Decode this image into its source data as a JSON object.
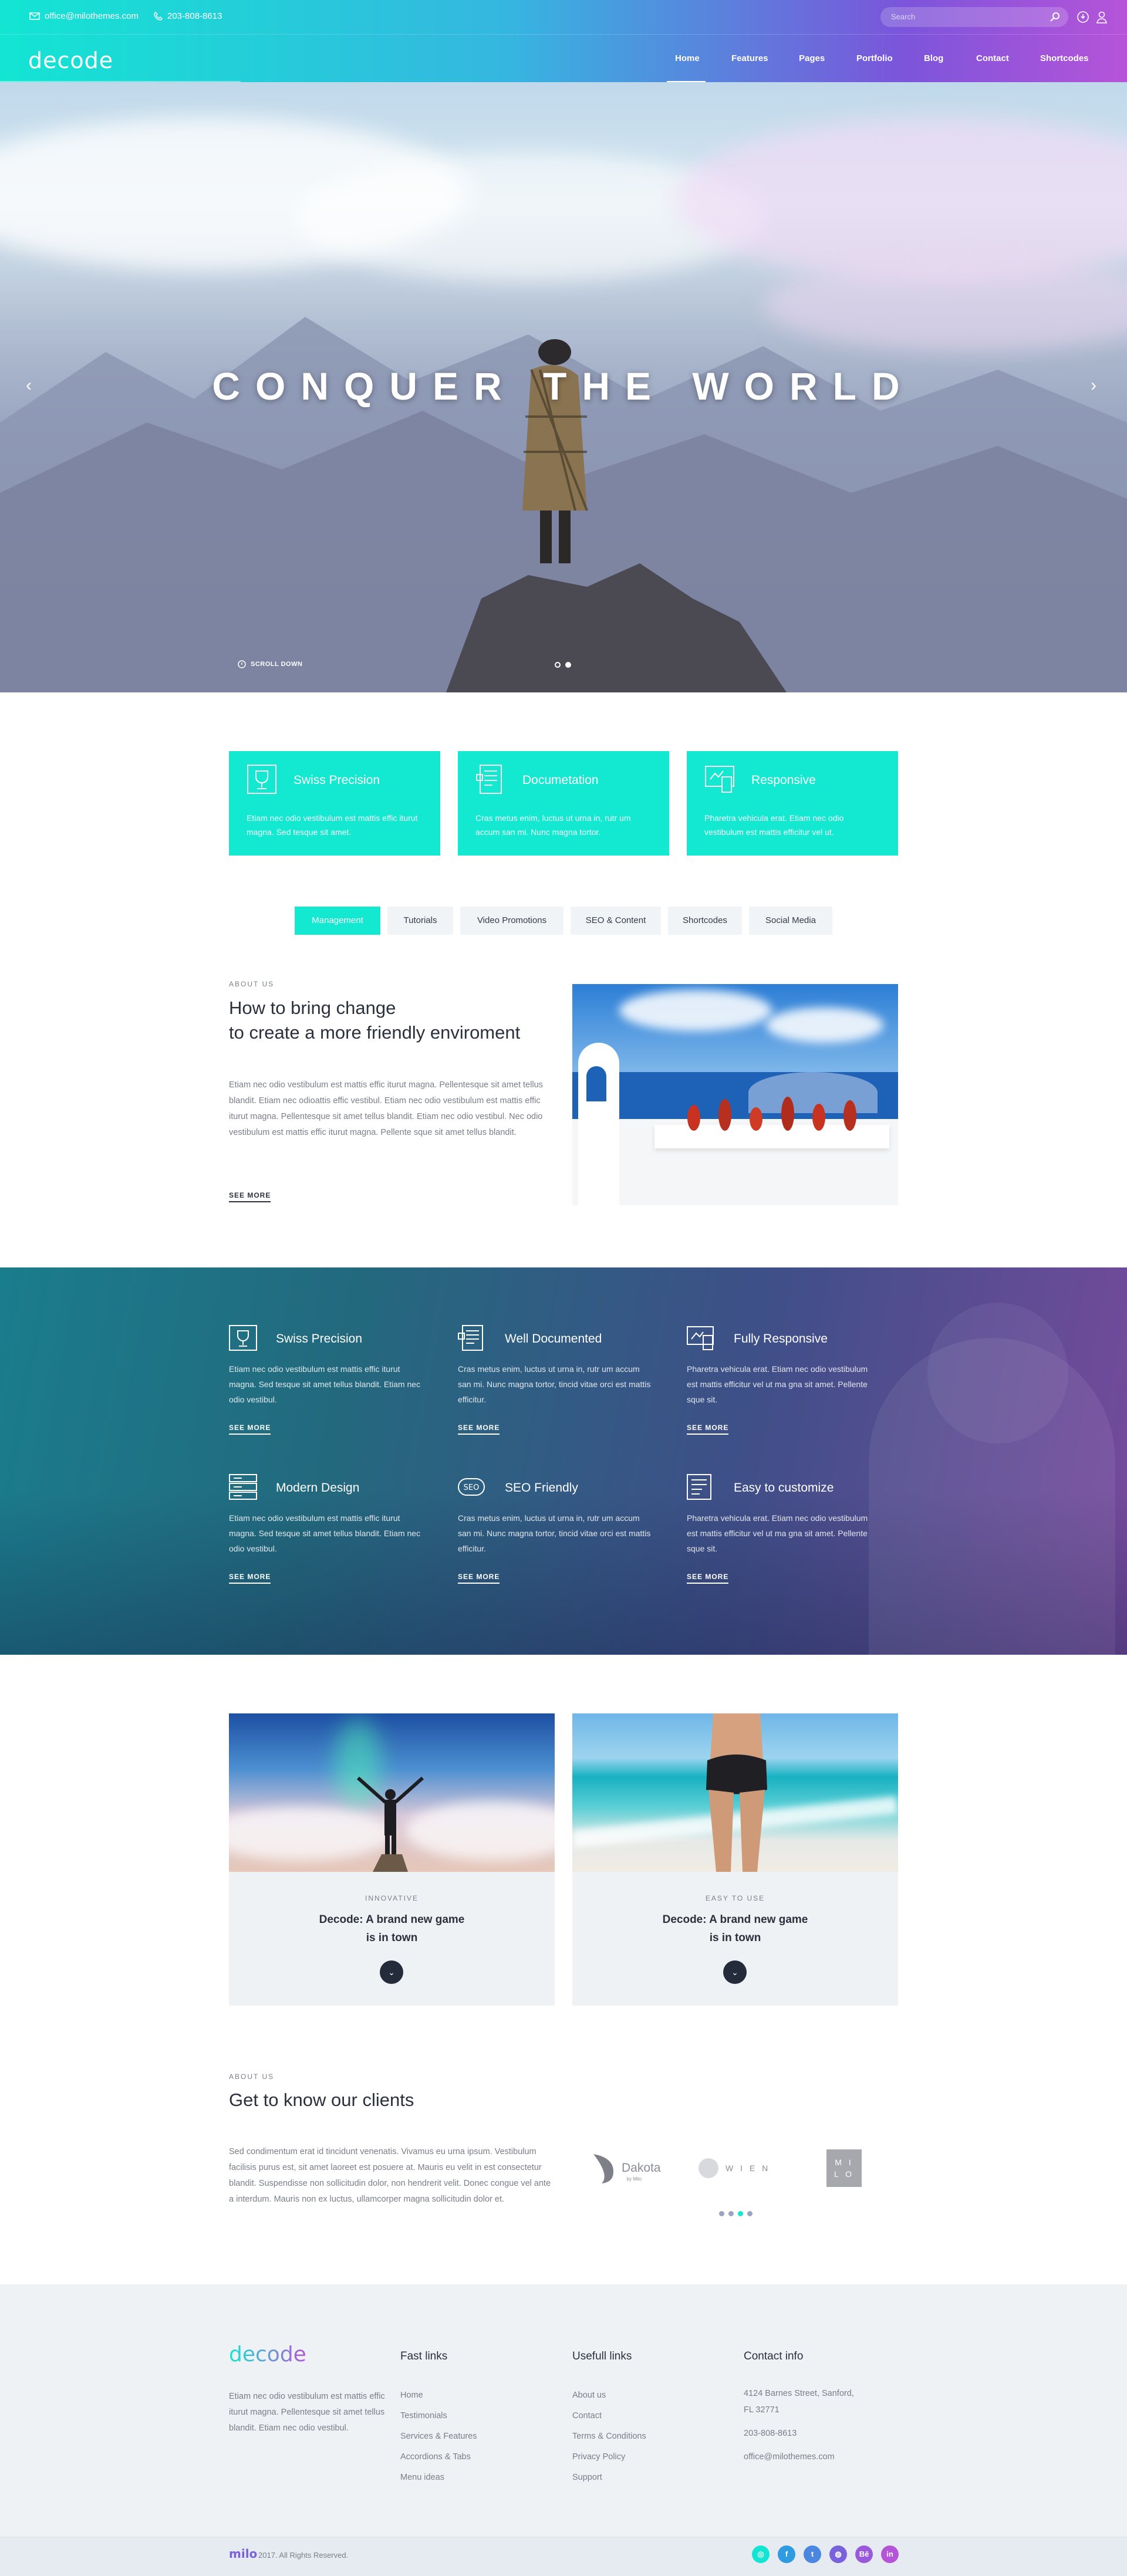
{
  "topbar": {
    "email": "office@milothemes.com",
    "phone": "203-808-8613",
    "search_placeholder": "Search",
    "icons": [
      "mail-icon",
      "phone-icon",
      "search-icon",
      "login-icon",
      "user-icon"
    ]
  },
  "nav": {
    "logo": "decode",
    "items": [
      "Home",
      "Features",
      "Pages",
      "Portfolio",
      "Blog",
      "Contact",
      "Shortcodes"
    ],
    "active": "Home"
  },
  "hero": {
    "title": "CONQUER THE WORLD",
    "scroll_label": "SCROLL DOWN",
    "prev_icon": "chevron-left-icon",
    "next_icon": "chevron-right-icon",
    "slides": 2,
    "active_slide": 2
  },
  "features": [
    {
      "icon": "trophy-icon",
      "title": "Swiss Precision",
      "text": "Etiam nec odio vestibulum est mattis effic iturut magna. Sed tesque sit amet."
    },
    {
      "icon": "document-icon",
      "title": "Documetation",
      "text": "Cras metus enim, luctus ut urna in, rutr um accum san mi. Nunc magna tortor."
    },
    {
      "icon": "responsive-icon",
      "title": "Responsive",
      "text": "Pharetra vehicula erat. Etiam nec odio vestibulum est mattis efficitur vel ut."
    }
  ],
  "tabs": [
    "Management",
    "Tutorials",
    "Video Promotions",
    "SEO & Content",
    "Shortcodes",
    "Social Media"
  ],
  "active_tab": "Management",
  "about": {
    "eyebrow": "ABOUT US",
    "title_line1": "How to bring change",
    "title_line2": "to create a more friendly enviroment",
    "text": "Etiam nec odio vestibulum est mattis effic iturut magna. Pellentesque sit amet tellus blandit. Etiam nec odioattis effic vestibul. Etiam nec odio vestibulum est mattis effic iturut magna. Pellentesque sit amet tellus blandit. Etiam nec odio vestibul. Nec odio vestibulum est mattis effic iturut magna. Pellente sque sit amet tellus blandit.",
    "link": "SEE MORE"
  },
  "band": [
    {
      "icon": "trophy-icon",
      "title": "Swiss Precision",
      "text": "Etiam nec odio vestibulum est mattis effic iturut magna. Sed tesque sit amet tellus blandit. Etiam nec odio vestibul.",
      "link": "SEE MORE"
    },
    {
      "icon": "document-icon",
      "title": "Well Documented",
      "text": "Cras metus enim, luctus ut urna in, rutr um accum san mi. Nunc magna tortor, tincid vitae orci est mattis efficitur.",
      "link": "SEE MORE"
    },
    {
      "icon": "responsive-icon",
      "title": "Fully Responsive",
      "text": "Pharetra vehicula erat. Etiam nec odio vestibulum est mattis efficitur vel ut ma gna sit amet. Pellente sque sit.",
      "link": "SEE MORE"
    },
    {
      "icon": "server-icon",
      "title": "Modern Design",
      "text": "Etiam nec odio vestibulum est mattis effic iturut magna. Sed tesque sit amet tellus blandit. Etiam nec odio vestibul.",
      "link": "SEE MORE"
    },
    {
      "icon": "seo-icon",
      "title": "SEO Friendly",
      "text": "Cras metus enim, luctus ut urna in, rutr um accum san mi. Nunc magna tortor, tincid vitae orci est mattis efficitur.",
      "link": "SEE MORE"
    },
    {
      "icon": "customize-icon",
      "title": "Easy to customize",
      "text": "Pharetra vehicula erat. Etiam nec odio vestibulum est mattis efficitur vel ut ma gna sit amet. Pellente sque sit.",
      "link": "SEE MORE"
    }
  ],
  "cards": [
    {
      "label": "INNOVATIVE",
      "title_line1": "Decode: A brand new game",
      "title_line2": "is in town",
      "button_icon": "chevron-down-icon"
    },
    {
      "label": "EASY TO USE",
      "title_line1": "Decode: A brand new game",
      "title_line2": "is in town",
      "button_icon": "chevron-down-icon"
    }
  ],
  "clients": {
    "eyebrow": "ABOUT US",
    "title": "Get to know our clients",
    "text": "Sed condimentum erat id tincidunt venenatis. Vivamus eu urna ipsum. Vestibulum facilisis purus est, sit amet laoreet est posuere at. Mauris eu velit in est consectetur blandit. Suspendisse non sollicitudin dolor, non hendrerit velit. Donec congue vel ante a interdum. Mauris non ex luctus, ullamcorper magna sollicitudin dolor et.",
    "logos": [
      {
        "name": "Dakota",
        "tag": "by Milo"
      },
      {
        "name": "W I E N"
      },
      {
        "name": "M I L O"
      }
    ],
    "pages": 4,
    "active_page": 3
  },
  "footer": {
    "logo": "decode",
    "about": "Etiam nec odio vestibulum est mattis effic iturut magna. Pellentesque sit amet tellus blandit. Etiam nec odio vestibul.",
    "fast_links_title": "Fast links",
    "fast_links": [
      "Home",
      "Testimonials",
      "Services & Features",
      "Accordions & Tabs",
      "Menu ideas"
    ],
    "useful_links_title": "Usefull links",
    "useful_links": [
      "About us",
      "Contact",
      "Terms & Conditions",
      "Privacy Policy",
      "Support"
    ],
    "contact_title": "Contact info",
    "address_line1": "4124 Barnes Street, Sanford,",
    "address_line2": "FL 32771",
    "phone": "203-808-8613",
    "email": "office@milothemes.com",
    "copyright": "2017. All Rights Reserved.",
    "brand_mark": "milo",
    "social": [
      {
        "icon": "tripadvisor-icon",
        "color": "#13e5d3",
        "glyph": "◎"
      },
      {
        "icon": "facebook-icon",
        "color": "#2e9be2",
        "glyph": "f"
      },
      {
        "icon": "twitter-icon",
        "color": "#4b86e0",
        "glyph": "t"
      },
      {
        "icon": "dribbble-icon",
        "color": "#7a62dc",
        "glyph": "◍"
      },
      {
        "icon": "behance-icon",
        "color": "#9a58da",
        "glyph": "Bē"
      },
      {
        "icon": "linkedin-icon",
        "color": "#b654d9",
        "glyph": "in"
      }
    ]
  }
}
